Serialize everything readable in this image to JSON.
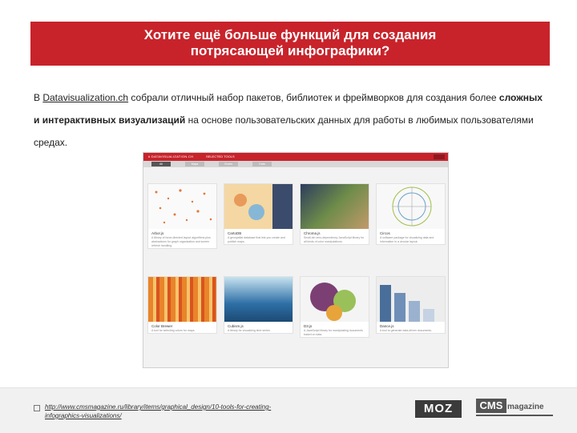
{
  "banner": {
    "line1": "Хотите ещё больше функций для создания",
    "line2": "потрясающей инфографики?"
  },
  "intro": {
    "prefix": "В ",
    "link": "Datavisualization.ch",
    "part1": " собрали отличный набор пакетов, библиотек и фреймворков для создания более ",
    "bold": "сложных и интерактивных визуализаций",
    "part2": " на основе пользовательских данных для работы в любимых пользователями средах."
  },
  "screenshot": {
    "site_title": "# DATAVISUALIZATION.CH",
    "section": "SELECTED TOOLS",
    "tabs": [
      "All",
      "Maps",
      "Charts",
      "Data"
    ],
    "cards": [
      {
        "title": "Arbor.js",
        "desc": "A library of force-directed layout algorithms plus abstractions for graph organization and screen refresh handling.",
        "color": "#f3d7c2"
      },
      {
        "title": "CartoDB",
        "desc": "A geospatial database that lets you create and publish maps.",
        "color": "#dfe4f4"
      },
      {
        "title": "Chroma.js",
        "desc": "Small-ish zero-dependency JavaScript library for all kinds of color manipulations.",
        "color": "#5a6e8c"
      },
      {
        "title": "Circos",
        "desc": "A software package for visualizing data and information in a circular layout.",
        "color": "#f5f5f5"
      },
      {
        "title": "Color Brewer",
        "desc": "A tool for selecting colors for maps.",
        "color": "#e8842a"
      },
      {
        "title": "Cubism.js",
        "desc": "A library for visualizing time series.",
        "color": "#2d6fa5"
      },
      {
        "title": "D3.js",
        "desc": "A JavaScript library for manipulating documents based on data.",
        "color": "#7c3f73"
      },
      {
        "title": "Dance.js",
        "desc": "A tool to generate data-driven documents.",
        "color": "#5f7fa8"
      }
    ]
  },
  "footer": {
    "url": "http://www.cmsmagazine.ru/library/items/graphical_design/10-tools-for-creating-infographics-visualizations/",
    "moz_logo": "MOZ",
    "cms_logo": "CMS",
    "cms_logo_suffix": "magazine"
  }
}
